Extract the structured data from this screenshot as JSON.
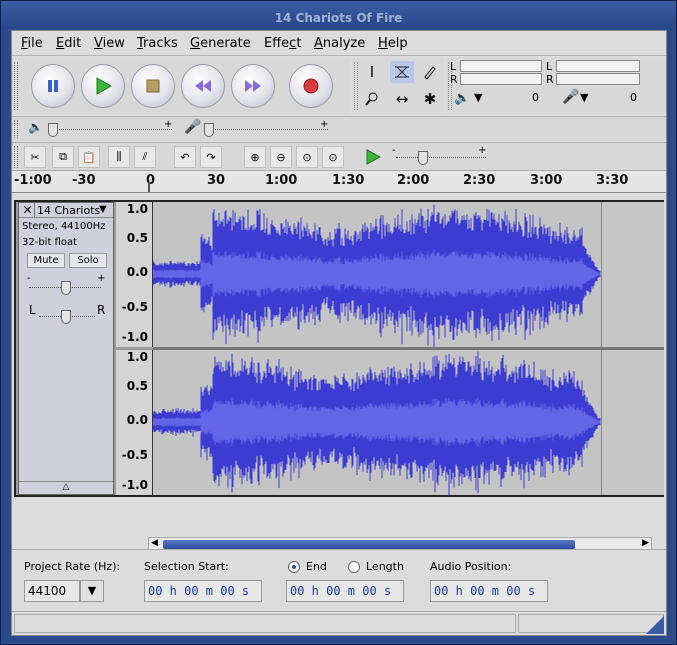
{
  "window": {
    "title": "14 Chariots Of Fire"
  },
  "menu": [
    "File",
    "Edit",
    "View",
    "Tracks",
    "Generate",
    "Effect",
    "Analyze",
    "Help"
  ],
  "menu_underline": [
    "F",
    "E",
    "V",
    "T",
    "G",
    "c",
    "A",
    "H"
  ],
  "meter": {
    "left": "L",
    "right": "R",
    "play_value": "0",
    "rec_value": "0"
  },
  "ruler": {
    "labels": [
      "-1:00",
      "-30",
      "0",
      "30",
      "1:00",
      "1:30",
      "2:00",
      "2:30",
      "3:00",
      "3:30"
    ]
  },
  "track": {
    "name": "14 Chariots",
    "format": "Stereo, 44100Hz",
    "bitdepth": "32-bit float",
    "mute": "Mute",
    "solo": "Solo",
    "gain_minus": "-",
    "gain_plus": "+",
    "pan_left": "L",
    "pan_right": "R",
    "scale": [
      "1.0",
      "0.5",
      "0.0",
      "-0.5",
      "-1.0"
    ],
    "wave_color": "#3c3cd2",
    "wave_rms_color": "#6464e6"
  },
  "selection": {
    "rate_label": "Project Rate (Hz):",
    "rate_value": "44100",
    "start_label": "Selection Start:",
    "end_label": "End",
    "length_label": "Length",
    "position_label": "Audio Position:",
    "time_value": "00 h 00 m 00 s"
  }
}
